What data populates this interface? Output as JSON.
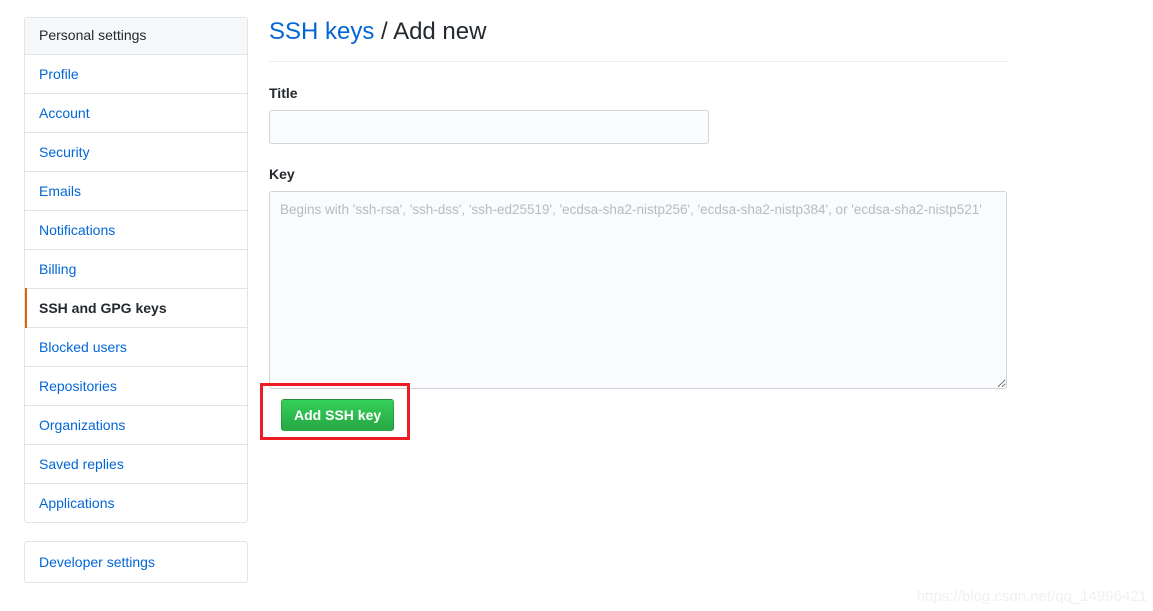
{
  "sidebar": {
    "header": "Personal settings",
    "items": [
      {
        "label": "Profile",
        "selected": false
      },
      {
        "label": "Account",
        "selected": false
      },
      {
        "label": "Security",
        "selected": false
      },
      {
        "label": "Emails",
        "selected": false
      },
      {
        "label": "Notifications",
        "selected": false
      },
      {
        "label": "Billing",
        "selected": false
      },
      {
        "label": "SSH and GPG keys",
        "selected": true
      },
      {
        "label": "Blocked users",
        "selected": false
      },
      {
        "label": "Repositories",
        "selected": false
      },
      {
        "label": "Organizations",
        "selected": false
      },
      {
        "label": "Saved replies",
        "selected": false
      },
      {
        "label": "Applications",
        "selected": false
      }
    ],
    "developer_settings": "Developer settings",
    "active_indicator_color": "#e36209",
    "link_color": "#0366d6"
  },
  "main": {
    "title": {
      "link_text": "SSH keys",
      "separator": "/",
      "current": "Add new"
    },
    "title_field": {
      "label": "Title",
      "value": "",
      "placeholder": ""
    },
    "key_field": {
      "label": "Key",
      "value": "",
      "placeholder": "Begins with 'ssh-rsa', 'ssh-dss', 'ssh-ed25519', 'ecdsa-sha2-nistp256', 'ecdsa-sha2-nistp384', or 'ecdsa-sha2-nistp521'"
    },
    "submit_button": {
      "label": "Add SSH key",
      "color": "#28a745",
      "highlight_color": "#ee1c25"
    }
  },
  "watermark": {
    "text": "https://blog.csdn.net/qq_14996421"
  }
}
